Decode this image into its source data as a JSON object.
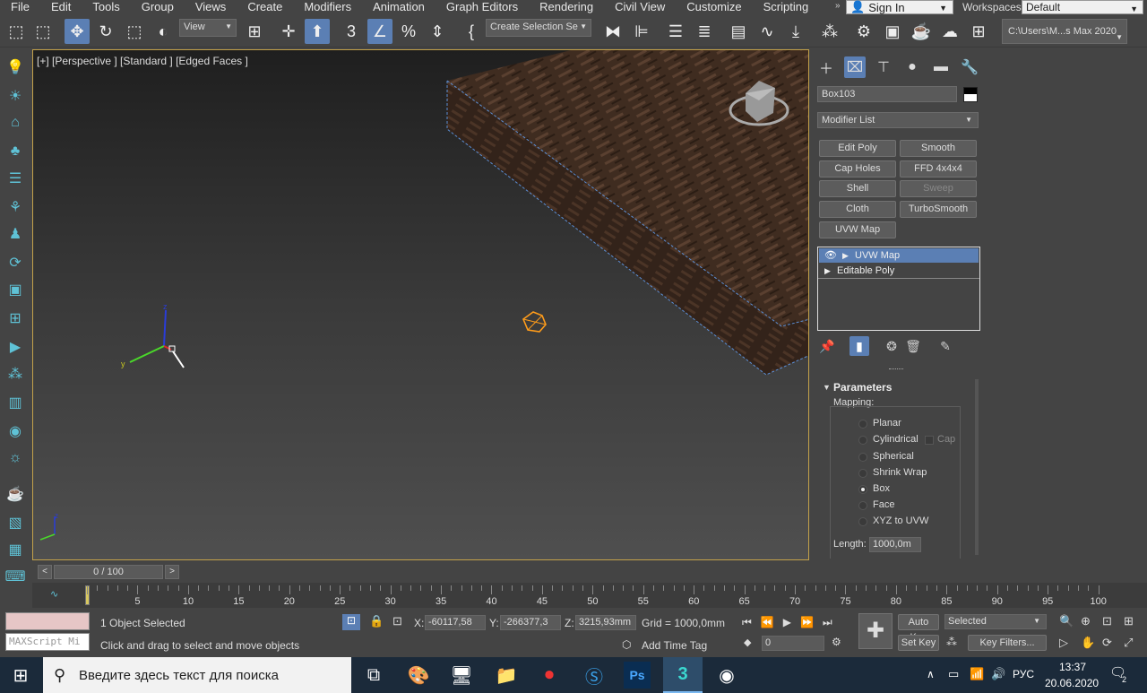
{
  "menu": [
    "File",
    "Edit",
    "Tools",
    "Group",
    "Views",
    "Create",
    "Modifiers",
    "Animation",
    "Graph Editors",
    "Rendering",
    "Civil View",
    "Customize",
    "Scripting"
  ],
  "signin": "Sign In",
  "workspaces": {
    "label": "Workspaces:",
    "value": "Default"
  },
  "toolbar": {
    "view_select": "View",
    "selection_set": "Create Selection Se",
    "path": "C:\\Users\\M...s Max 2020"
  },
  "viewport": {
    "label": "[+] [Perspective ] [Standard ] [Edged Faces ]"
  },
  "panel": {
    "object_name": "Box103",
    "modifier_list": "Modifier List",
    "buttons": [
      "Edit Poly",
      "Smooth",
      "Cap Holes",
      "FFD 4x4x4",
      "Shell",
      "Sweep",
      "Cloth",
      "TurboSmooth",
      "UVW Map"
    ],
    "stack": [
      "UVW Map",
      "Editable Poly"
    ],
    "params_title": "Parameters",
    "mapping_label": "Mapping:",
    "mapping": [
      "Planar",
      "Cylindrical",
      "Spherical",
      "Shrink Wrap",
      "Box",
      "Face",
      "XYZ to UVW"
    ],
    "mapping_selected": "Box",
    "cap": "Cap",
    "length_label": "Length:",
    "length_value": "1000,0m"
  },
  "timeline": {
    "slider": "0 / 100",
    "ticks": [
      "5",
      "10",
      "15",
      "20",
      "25",
      "30",
      "35",
      "40",
      "45",
      "50",
      "55",
      "60",
      "65",
      "70",
      "75",
      "80",
      "85",
      "90",
      "95",
      "100"
    ]
  },
  "status": {
    "selected": "1 Object Selected",
    "prompt": "Click and drag to select and move objects",
    "maxscript": "MAXScript Mi",
    "x_label": "X:",
    "x": "-60117,58",
    "y_label": "Y:",
    "y": "-266377,3",
    "z_label": "Z:",
    "z": "3215,93mm",
    "grid": "Grid = 1000,0mm",
    "add_time_tag": "Add Time Tag",
    "auto_key": "Auto Key",
    "selected_dropdown": "Selected",
    "set_key": "Set Key",
    "key_filters": "Key Filters...",
    "frame": "0"
  },
  "taskbar": {
    "search": "Введите здесь текст для поиска",
    "lang": "РУС",
    "time": "13:37",
    "date": "20.06.2020",
    "notif": "2"
  }
}
